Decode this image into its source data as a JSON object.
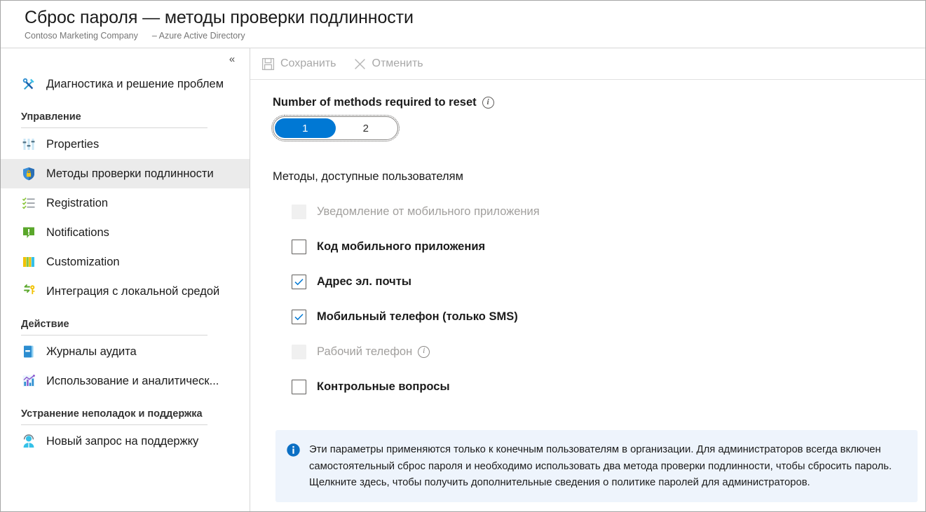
{
  "header": {
    "title": "Сброс пароля — методы проверки подлинности",
    "org": "Contoso Marketing Company",
    "service": "– Azure Active Directory"
  },
  "sidebar": {
    "collapse_label": "«",
    "top_items": [
      {
        "label": "Диагностика и решение проблем",
        "icon": "tools-icon"
      }
    ],
    "sections": [
      {
        "title": "Управление",
        "items": [
          {
            "label": "Properties",
            "icon": "sliders-icon",
            "selected": false
          },
          {
            "label": "Методы проверки подлинности",
            "icon": "shield-lock-icon",
            "selected": true
          },
          {
            "label": "Registration",
            "icon": "checklist-icon",
            "selected": false
          },
          {
            "label": "Notifications",
            "icon": "notification-icon",
            "selected": false
          },
          {
            "label": "Customization",
            "icon": "customization-icon",
            "selected": false
          },
          {
            "label": "Интеграция с локальной средой",
            "icon": "integration-icon",
            "selected": false
          }
        ]
      },
      {
        "title": "Действие",
        "items": [
          {
            "label": "Журналы аудита",
            "icon": "audit-book-icon",
            "selected": false
          },
          {
            "label": "Использование и аналитическ...",
            "icon": "analytics-chart-icon",
            "selected": false
          }
        ]
      },
      {
        "title": "Устранение неполадок и поддержка",
        "items": [
          {
            "label": "Новый запрос на поддержку",
            "icon": "support-agent-icon",
            "selected": false
          }
        ]
      }
    ]
  },
  "toolbar": {
    "save_label": "Сохранить",
    "cancel_label": "Отменить"
  },
  "main": {
    "methods_count_label": "Number of methods required to reset",
    "methods_count_options": [
      "1",
      "2"
    ],
    "methods_count_selected": "1",
    "available_methods_label": "Методы, доступные пользователям",
    "methods": [
      {
        "label": "Уведомление от мобильного приложения",
        "checked": false,
        "disabled": true,
        "info": false
      },
      {
        "label": "Код мобильного приложения",
        "checked": false,
        "disabled": false,
        "info": false
      },
      {
        "label": "Адрес эл. почты",
        "checked": true,
        "disabled": false,
        "info": false
      },
      {
        "label": "Мобильный телефон (только SMS)",
        "checked": true,
        "disabled": false,
        "info": false
      },
      {
        "label": "Рабочий телефон",
        "checked": false,
        "disabled": true,
        "info": true
      },
      {
        "label": "Контрольные вопросы",
        "checked": false,
        "disabled": false,
        "info": false
      }
    ],
    "notice": "Эти параметры применяются только к конечным пользователям в организации. Для администраторов всегда включен самостоятельный сброс пароля и необходимо использовать два метода проверки подлинности, чтобы сбросить пароль. Щелкните здесь, чтобы получить дополнительные сведения о политике паролей для администраторов."
  },
  "colors": {
    "accent": "#0078d4",
    "selected_nav_bg": "#ebebeb",
    "notice_bg": "#eef4fc",
    "disabled_text": "#a19f9d"
  }
}
